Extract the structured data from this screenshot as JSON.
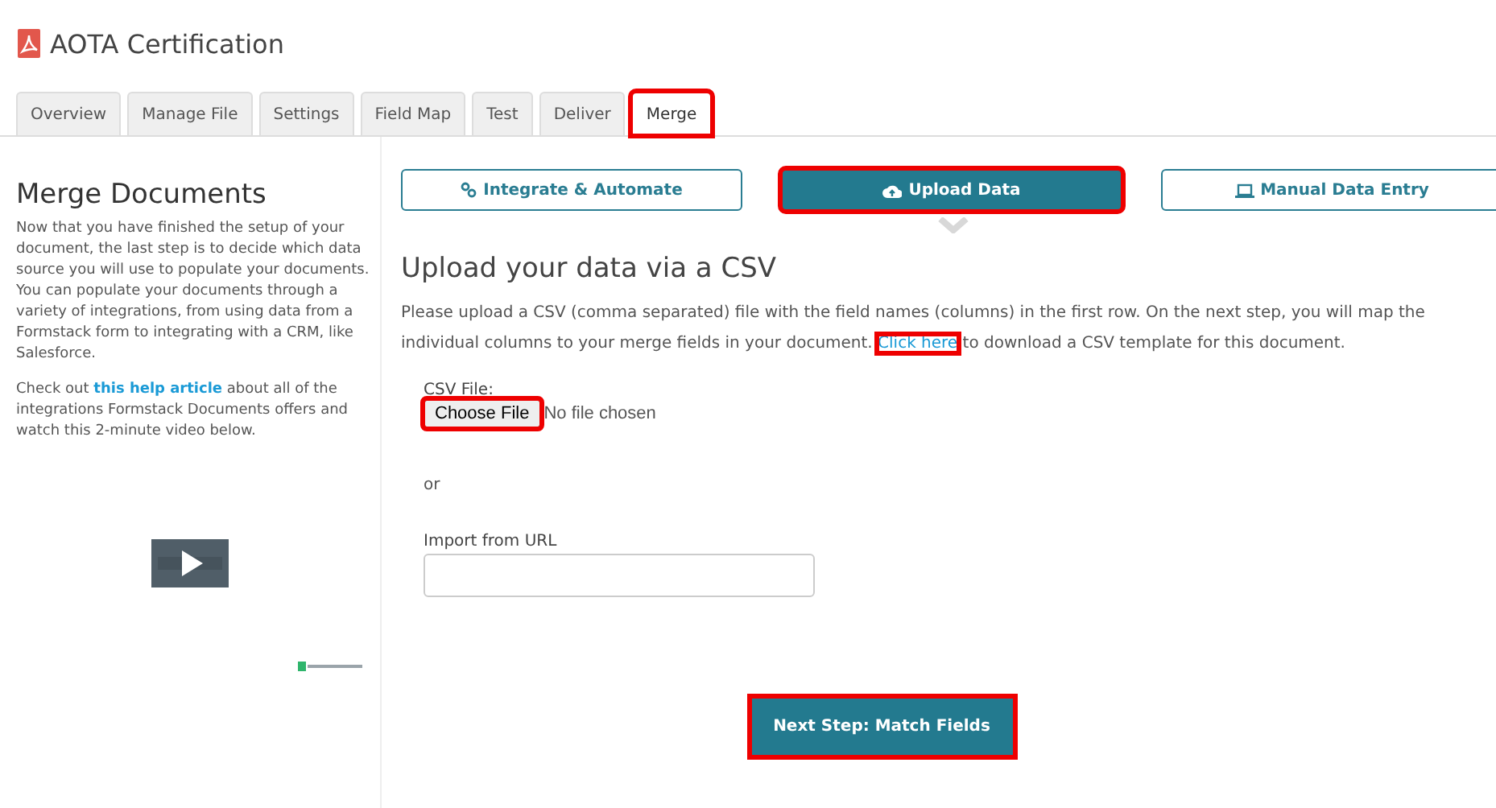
{
  "document": {
    "title": "AOTA Certification"
  },
  "tabs": [
    {
      "label": "Overview",
      "selected": false,
      "highlighted": false
    },
    {
      "label": "Manage File",
      "selected": false,
      "highlighted": false
    },
    {
      "label": "Settings",
      "selected": false,
      "highlighted": false
    },
    {
      "label": "Field Map",
      "selected": false,
      "highlighted": false
    },
    {
      "label": "Test",
      "selected": false,
      "highlighted": false
    },
    {
      "label": "Deliver",
      "selected": false,
      "highlighted": false
    },
    {
      "label": "Merge",
      "selected": true,
      "highlighted": true
    }
  ],
  "sidebar": {
    "title": "Merge Documents",
    "intro": "Now that you have finished the setup of your document, the last step is to decide which data source you will use to populate your documents. You can populate your documents through a variety of integrations, from using data from a Formstack form to integrating with a CRM, like Salesforce.",
    "note_before": "Check out",
    "note_link": "this help article",
    "note_after": "about all of the integrations Formstack Documents offers and watch this 2-minute video below."
  },
  "modes": [
    {
      "label": "Integrate & Automate",
      "selected": false,
      "highlighted": false
    },
    {
      "label": "Upload Data",
      "selected": true,
      "highlighted": true
    },
    {
      "label": "Manual Data Entry",
      "selected": false,
      "highlighted": false
    }
  ],
  "upload": {
    "heading": "Upload your data via a CSV",
    "text_before": "Please upload a CSV (comma separated) file with the field names (columns) in the first row. On the next step, you will map the individual columns to your merge fields in your document.",
    "link": {
      "label": "Click here",
      "highlighted": true
    },
    "text_after": "to download a CSV template for this document.",
    "file_label": "CSV File:",
    "choose_button": {
      "label": "Choose File",
      "highlighted": true
    },
    "file_status": "No file chosen",
    "or": "or",
    "url_label": "Import from URL",
    "next_button": {
      "label": "Next Step: Match Fields",
      "highlighted": true
    }
  }
}
